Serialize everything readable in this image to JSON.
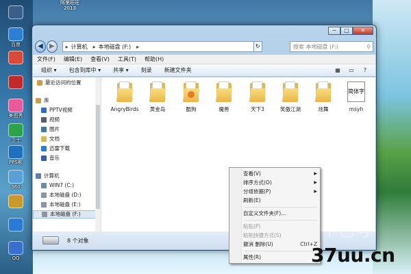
{
  "desktop": {
    "top_icon_label": "阿里旺旺\n2013",
    "icons": [
      {
        "label": "",
        "color": "#3a5f8a"
      },
      {
        "label": "百度",
        "color": "#2b7fd6"
      },
      {
        "label": "",
        "color": "#d84a3a"
      },
      {
        "label": "",
        "color": "#c02a2a"
      },
      {
        "label": "美图秀",
        "color": "#e85a9a"
      },
      {
        "label": "卫士",
        "color": "#2aa34a"
      },
      {
        "label": "PPS影",
        "color": "#1f6fbf"
      },
      {
        "label": "360",
        "color": "#5aa0d8"
      },
      {
        "label": "",
        "color": "#c99a2a"
      },
      {
        "label": "",
        "color": "#2a7ad8"
      },
      {
        "label": "QQ",
        "color": "#3a6fd0"
      }
    ]
  },
  "window": {
    "caption": {
      "minimize": "─",
      "maximize": "□",
      "close": "✕"
    },
    "address": {
      "crumbs": [
        "计算机",
        "本地磁盘 (F:)"
      ],
      "search_placeholder": "搜索 本地磁盘 (F:)"
    },
    "menubar": [
      "文件(F)",
      "编辑(E)",
      "查看(V)",
      "工具(T)",
      "帮助(H)"
    ],
    "toolbar": [
      "组织 ▾",
      "包含到库中 ▾",
      "共享 ▾",
      "刻录",
      "新建文件夹"
    ],
    "sidebar": [
      {
        "label": "最近访问的位置",
        "color": "#c8a24a"
      },
      {
        "label": "库",
        "color": "#c8a24a"
      },
      {
        "label": "PPTV视频",
        "color": "#2e6fbf"
      },
      {
        "label": "视频",
        "color": "#555f6e"
      },
      {
        "label": "图片",
        "color": "#3a7a9e"
      },
      {
        "label": "文档",
        "color": "#d8b84a"
      },
      {
        "label": "迅雷下载",
        "color": "#2a7ad8"
      },
      {
        "label": "音乐",
        "color": "#3a5fa8"
      },
      {
        "label": "计算机",
        "color": "#5a7fa8"
      },
      {
        "label": "WIN7 (C:)",
        "color": "#6a8aa8"
      },
      {
        "label": "本地磁盘 (D:)",
        "color": "#8a96a3"
      },
      {
        "label": "本地磁盘 (E:)",
        "color": "#8a96a3"
      },
      {
        "label": "本地磁盘 (F:)",
        "color": "#8a96a3"
      }
    ],
    "files": [
      {
        "name": "AngryBirds",
        "kind": "folder"
      },
      {
        "name": "黄金岛",
        "kind": "folder"
      },
      {
        "name": "酷狗",
        "kind": "folder-badge"
      },
      {
        "name": "魔兽",
        "kind": "folder"
      },
      {
        "name": "天下3",
        "kind": "folder"
      },
      {
        "name": "笑傲江湖",
        "kind": "folder"
      },
      {
        "name": "炫舞",
        "kind": "folder"
      },
      {
        "name": "msyh",
        "kind": "font",
        "glyph": "简体字"
      }
    ],
    "status": "8 个对象"
  },
  "context_menu": {
    "items": [
      {
        "label": "查看(V)",
        "submenu": true
      },
      {
        "label": "排序方式(O)",
        "submenu": true
      },
      {
        "label": "分组依据(P)",
        "submenu": true
      },
      {
        "label": "刷新(E)"
      },
      {
        "label": "自定义文件夹(F)..."
      },
      {
        "label": "粘贴(P)",
        "disabled": true
      },
      {
        "label": "粘贴快捷方式(S)",
        "disabled": true
      },
      {
        "label": "撤消 删除(U)",
        "accel": "Ctrl+Z"
      },
      {
        "label": "属性(R)"
      }
    ]
  },
  "watermark": "37uu.cn",
  "watermark_faint": "十巴号"
}
